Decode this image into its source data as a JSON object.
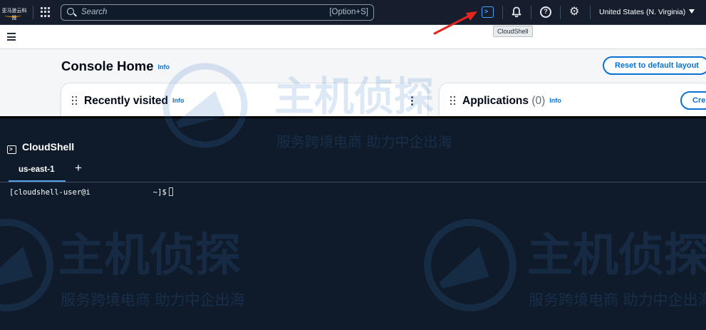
{
  "nav": {
    "logo_text": "亚马逊云科技",
    "search_placeholder": "Search",
    "search_shortcut": "[Option+S]",
    "region": "United States (N. Virginia)",
    "tooltip": "CloudShell"
  },
  "console": {
    "title": "Console Home",
    "title_info": "Info",
    "reset_label": "Reset to default layout",
    "recently_visited": {
      "title": "Recently visited",
      "info": "Info"
    },
    "applications": {
      "title": "Applications",
      "count": "(0)",
      "info": "Info",
      "create_label": "Cre"
    }
  },
  "cloudshell": {
    "title": "CloudShell",
    "tab_label": "us-east-1",
    "add_tab": "+",
    "prompt_prefix": "[cloudshell-user@i",
    "prompt_suffix": "~]$"
  },
  "watermark": {
    "name": "主机侦探",
    "slogan": "服务跨境电商 助力中企出海"
  },
  "colors": {
    "nav_bg": "#161e2d",
    "shell_bg": "#0f1b2a",
    "accent_blue": "#0972d3",
    "cloudshell_icon": "#4aa3ff",
    "annotation_arrow": "#e5261f"
  }
}
